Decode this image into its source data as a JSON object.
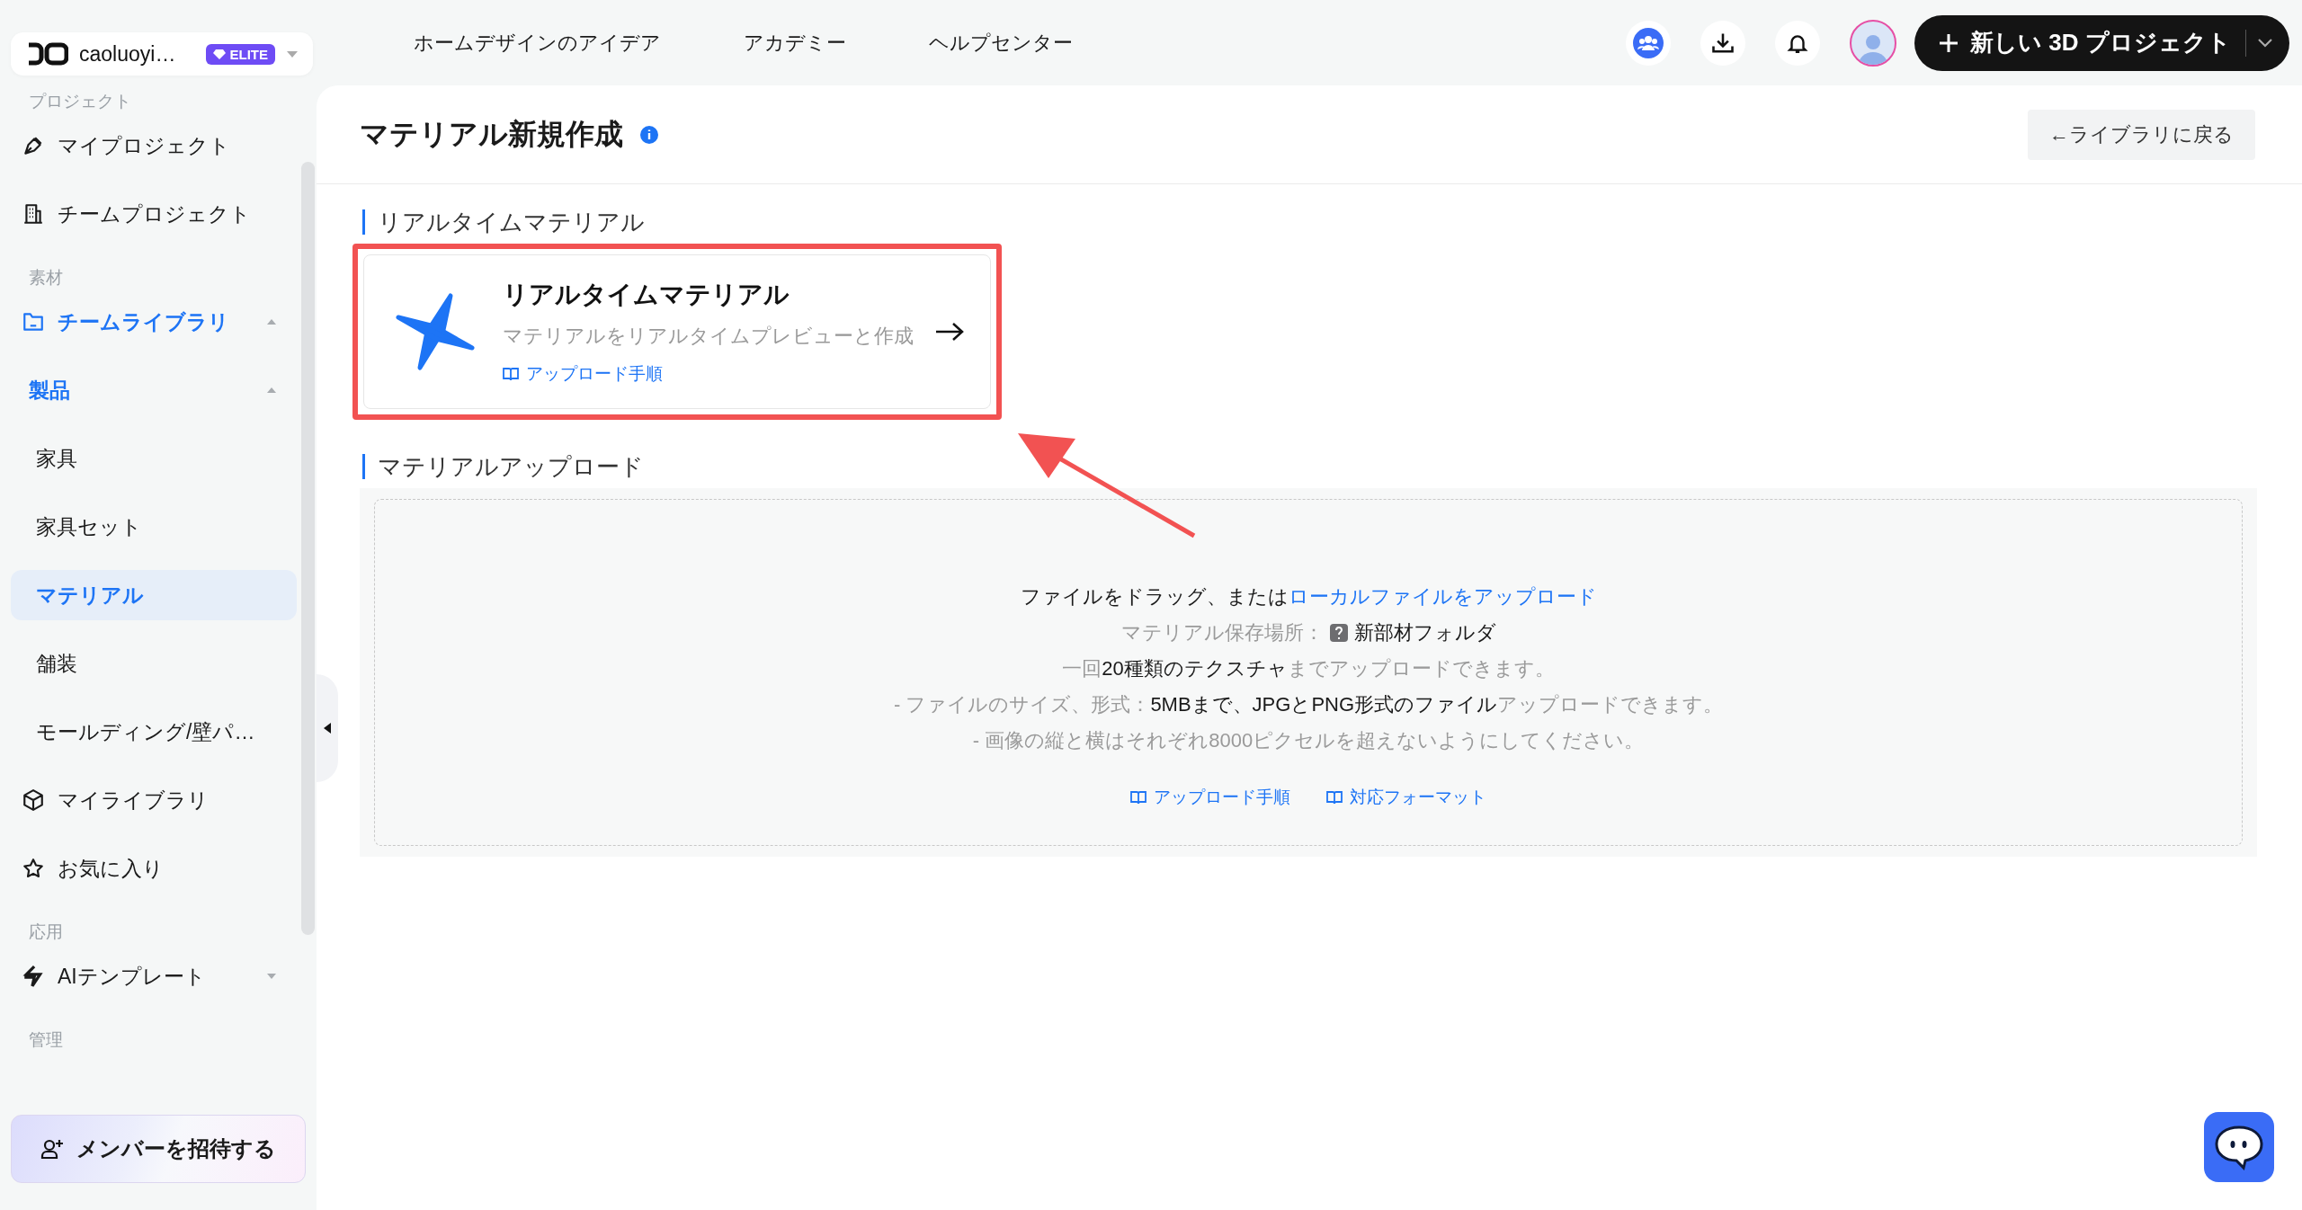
{
  "account": {
    "name": "caoluoyi…",
    "badge": "ELITE"
  },
  "sidebar": {
    "sections": [
      {
        "label": "プロジェクト",
        "items": [
          {
            "label": "マイプロジェクト",
            "selected": false
          },
          {
            "label": "チームプロジェクト",
            "selected": false
          }
        ]
      },
      {
        "label": "素材",
        "items": [
          {
            "label": "チームライブラリ",
            "selected": false,
            "expanded": true,
            "children": [
              {
                "label": "製品",
                "selected": false,
                "expanded": true,
                "children": [
                  {
                    "label": "家具",
                    "selected": false
                  },
                  {
                    "label": "家具セット",
                    "selected": false
                  },
                  {
                    "label": "マテリアル",
                    "selected": true
                  },
                  {
                    "label": "舗装",
                    "selected": false
                  },
                  {
                    "label": "モールディング/壁パ…",
                    "selected": false
                  }
                ]
              }
            ]
          },
          {
            "label": "マイライブラリ",
            "selected": false
          },
          {
            "label": "お気に入り",
            "selected": false
          }
        ]
      },
      {
        "label": "応用",
        "items": [
          {
            "label": "AIテンプレート",
            "selected": false,
            "expanded": false
          }
        ]
      },
      {
        "label": "管理"
      }
    ],
    "invite_button": "メンバーを招待する"
  },
  "top_nav": [
    {
      "label": "ホームデザインのアイデア"
    },
    {
      "label": "アカデミー"
    },
    {
      "label": "ヘルプセンター"
    }
  ],
  "new_project_button": "新しい 3D プロジェクト",
  "page": {
    "title": "マテリアル新規作成",
    "back_button": "←ライブラリに戻る",
    "realtime": {
      "label": "リアルタイムマテリアル",
      "card": {
        "title": "リアルタイムマテリアル",
        "description": "マテリアルをリアルタイムプレビューと作成",
        "link": "アップロード手順"
      }
    },
    "upload": {
      "label": "マテリアルアップロード",
      "lines": [
        [
          {
            "text": "ファイルをドラッグ、または",
            "kind": "strong"
          },
          {
            "text": "ローカルファイルをアップロード",
            "kind": "link"
          }
        ],
        [
          {
            "text": "マテリアル保存場所：",
            "kind": "muted"
          },
          {
            "kind": "icon"
          },
          {
            "text": "新部材フォルダ",
            "kind": "strong"
          }
        ],
        [
          {
            "text": "一回",
            "kind": "muted"
          },
          {
            "text": "20種類のテクスチャ",
            "kind": "strong"
          },
          {
            "text": "までアップロードできます。",
            "kind": "muted"
          }
        ],
        [
          {
            "text": "- ファイルのサイズ、形式：",
            "kind": "muted"
          },
          {
            "text": "5MBまで、JPGとPNG形式のファイル",
            "kind": "strong"
          },
          {
            "text": "アップロードできます。",
            "kind": "muted"
          }
        ],
        [
          {
            "text": "- 画像の縦と横はそれぞれ8000ピクセルを超えないようにしてください。",
            "kind": "muted"
          }
        ]
      ],
      "links": [
        "アップロード手順",
        "対応フォーマット"
      ]
    }
  }
}
